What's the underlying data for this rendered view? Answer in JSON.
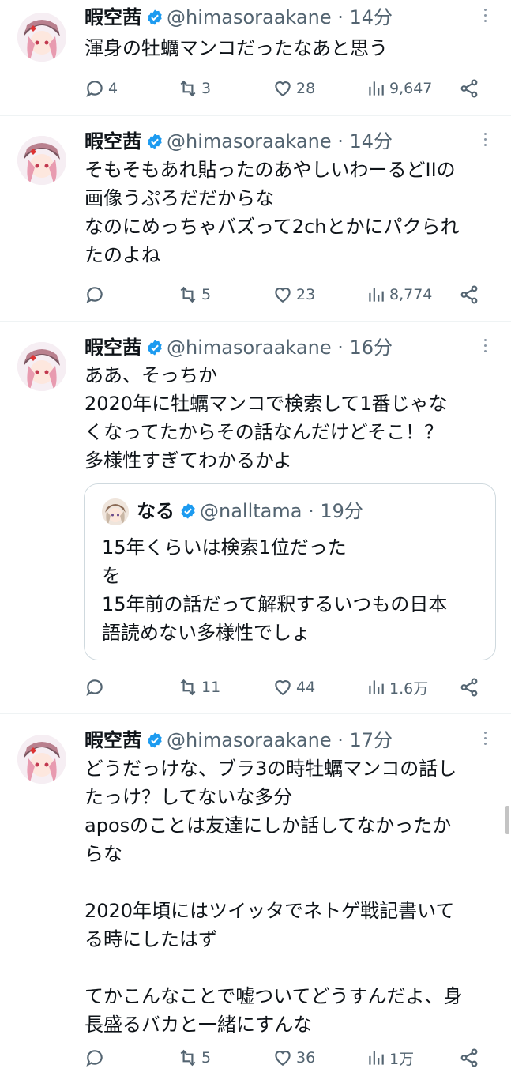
{
  "tweets": [
    {
      "name": "暇空茜",
      "handle": "@himasoraakane",
      "dot": "·",
      "time": "14分",
      "lines": [
        "渾身の牡蠣マンコだったなあと思う"
      ],
      "replies": "4",
      "retweets": "3",
      "likes": "28",
      "views": "9,647"
    },
    {
      "name": "暇空茜",
      "handle": "@himasoraakane",
      "dot": "·",
      "time": "14分",
      "lines": [
        "そもそもあれ貼ったのあやしいわーるどIIの",
        "画像うぷろだだからな",
        "なのにめっちゃバズって2chとかにパクられ",
        "たのよね"
      ],
      "replies": "",
      "retweets": "5",
      "likes": "23",
      "views": "8,774"
    },
    {
      "name": "暇空茜",
      "handle": "@himasoraakane",
      "dot": "·",
      "time": "16分",
      "lines": [
        "ああ、そっちか",
        "2020年に牡蠣マンコで検索して1番じゃな",
        "くなってたからその話なんだけどそこ！？",
        "多様性すぎてわかるかよ"
      ],
      "quote": {
        "name": "なる",
        "handle": "@nalltama",
        "dot": "·",
        "time": "19分",
        "lines": [
          "15年くらいは検索1位だった",
          "を",
          "15年前の話だって解釈するいつもの日本",
          "語読めない多様性でしょ"
        ]
      },
      "replies": "",
      "retweets": "11",
      "likes": "44",
      "views": "1.6万"
    },
    {
      "name": "暇空茜",
      "handle": "@himasoraakane",
      "dot": "·",
      "time": "17分",
      "lines": [
        "どうだっけな、ブラ3の時牡蠣マンコの話し",
        "たっけ？してないな多分",
        "aposのことは友達にしか話してなかったか",
        "らな",
        "",
        "2020年頃にはツイッタでネトゲ戦記書いて",
        "る時にしたはず",
        "",
        "てかこんなことで嘘ついてどうすんだよ、身",
        "長盛るバカと一緒にすんな"
      ],
      "replies": "",
      "retweets": "5",
      "likes": "36",
      "views": "1万"
    }
  ],
  "icons": {
    "reply": "reply-icon",
    "retweet": "retweet-icon",
    "like": "heart-icon",
    "views": "views-icon",
    "share": "share-icon",
    "verified": "verified-badge-icon",
    "more": "more-icon"
  },
  "colors": {
    "text": "#0f1419",
    "muted": "#536471",
    "verified": "#1d9bf0",
    "border": "#cfd9de",
    "divider": "#eff3f4"
  }
}
